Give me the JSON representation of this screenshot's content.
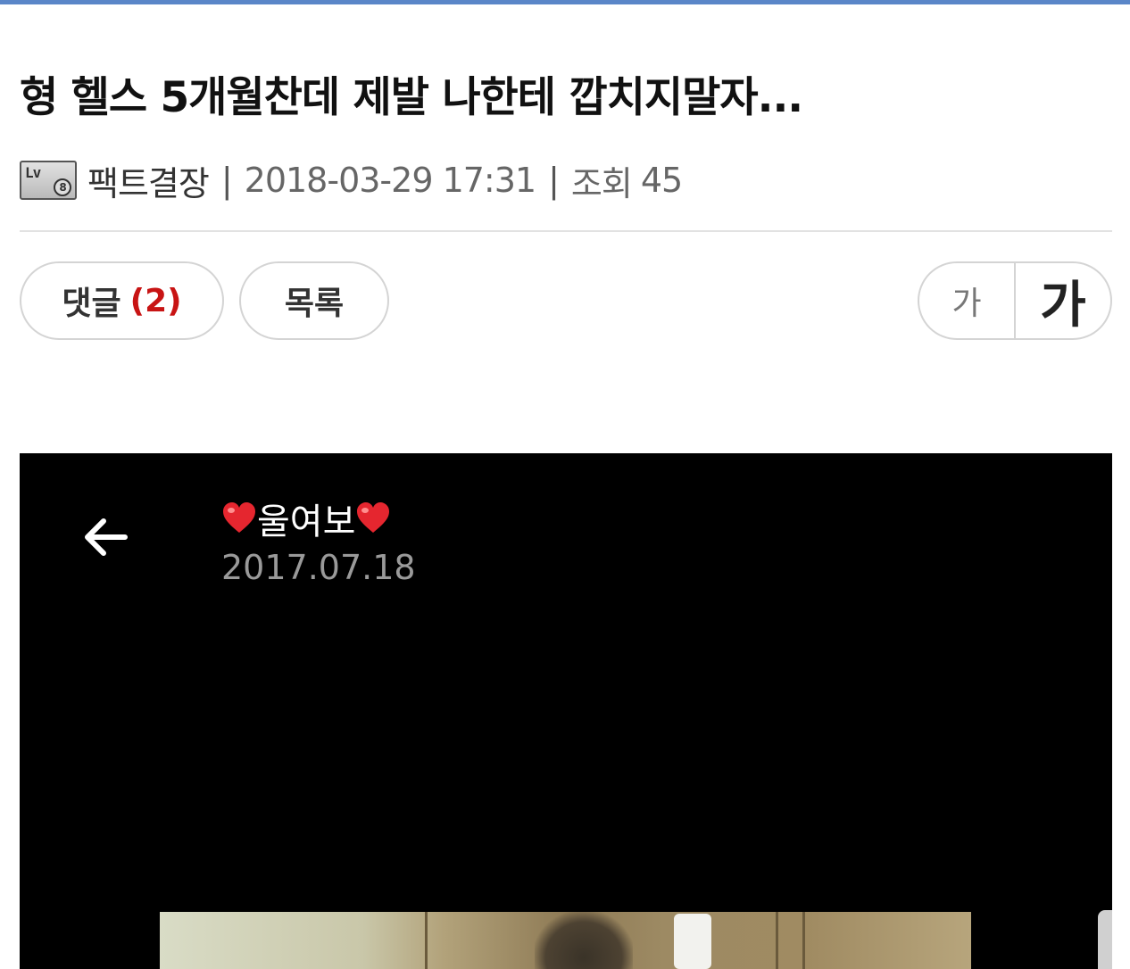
{
  "post": {
    "title": "형 헬스 5개월찬데 제발 나한테 깝치지말자...",
    "author": "팩트결장",
    "author_level_icon": "level-badge-icon",
    "datetime": "2018-03-29 17:31",
    "views_label": "조회",
    "views": "45"
  },
  "actions": {
    "comments_label": "댓글",
    "comments_count": "(2)",
    "list_label": "목록",
    "font_small": "가",
    "font_large": "가"
  },
  "embedded_screenshot": {
    "title": "울여보",
    "heart_icon": "heart-icon",
    "date": "2017.07.18",
    "back_icon": "arrow-left-icon"
  },
  "colors": {
    "accent_bar": "#5a86c8",
    "comment_count": "#c81414",
    "media_background": "#000000"
  }
}
